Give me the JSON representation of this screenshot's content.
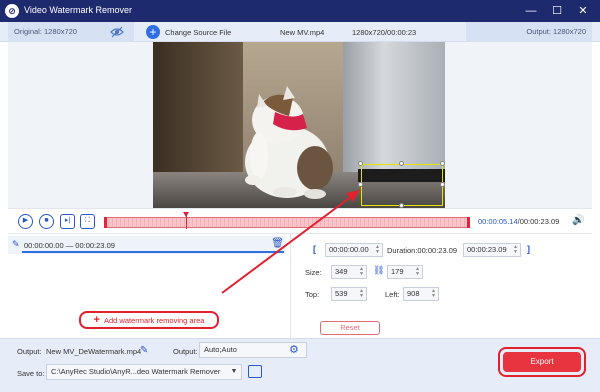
{
  "window": {
    "title": "Video Watermark Remover",
    "minimize": "—",
    "maximize": "☐",
    "close": "✕"
  },
  "infobar": {
    "original": "Original: 1280x720",
    "change_source": "Change Source File",
    "filename": "New MV.mp4",
    "meta": "1280x720/00:00:23",
    "output": "Output: 1280x720"
  },
  "player": {
    "current_time": "00:00:05.14",
    "total_time": "/00:00:23.09",
    "progress": 0.223
  },
  "segment": {
    "range": "00:00:00.00 — 00:00:23.09"
  },
  "add_area": {
    "label": "Add watermark removing area"
  },
  "settings": {
    "bracket_open": "[",
    "bracket_close": "]",
    "start": "00:00:00.00",
    "duration_label": "Duration:00:00:23.09",
    "end": "00:00:23.09",
    "size_label": "Size:",
    "width": "349",
    "height": "179",
    "top_label": "Top:",
    "top": "539",
    "left_label": "Left:",
    "left": "908",
    "reset": "Reset"
  },
  "bottom": {
    "output_label": "Output:",
    "output_name": "New MV_DeWatermark.mp4",
    "format_label": "Output:",
    "format_value": "Auto;Auto",
    "save_label": "Save to:",
    "save_path": "C:\\AnyRec Studio\\AnyR...deo Watermark Remover",
    "export": "Export"
  },
  "colors": {
    "titlebar": "#1e2a6e",
    "accent": "#2a57c9",
    "highlight": "#e0212e"
  }
}
